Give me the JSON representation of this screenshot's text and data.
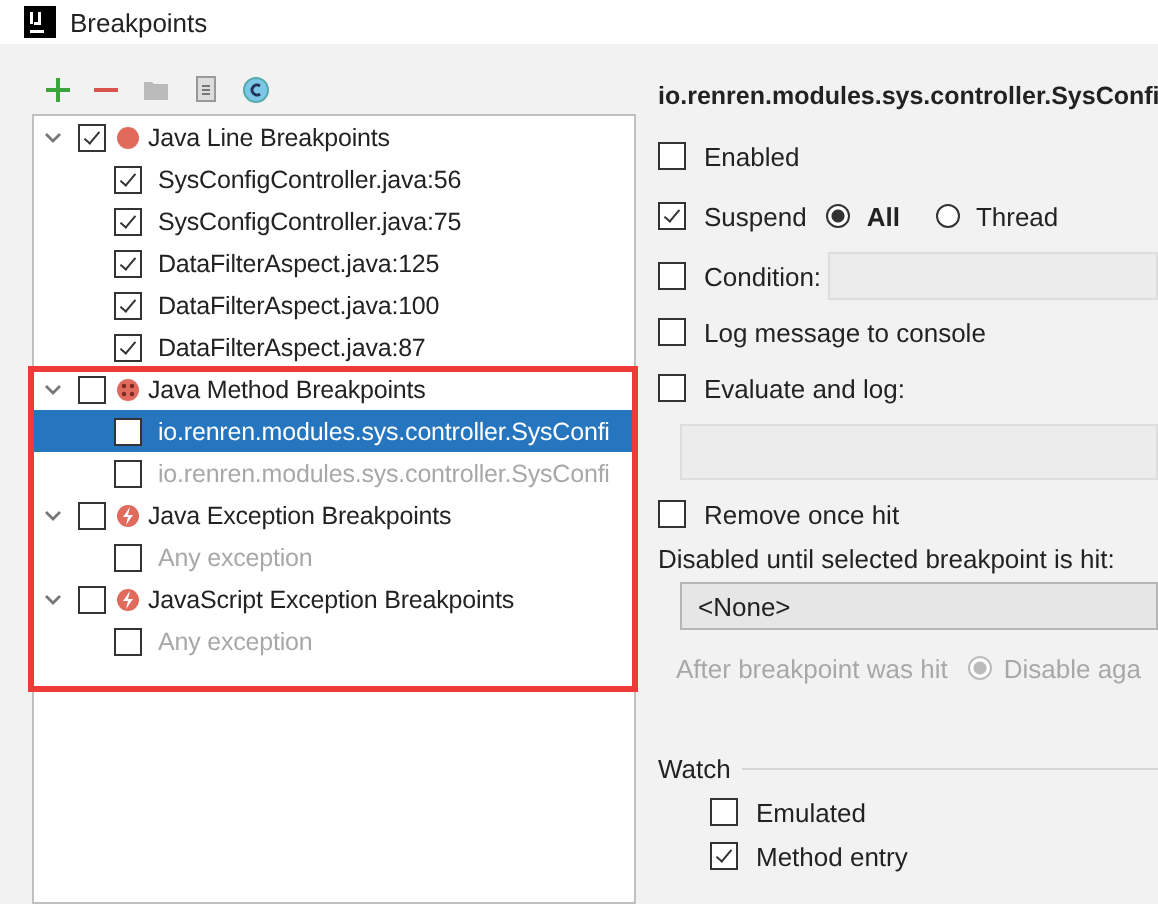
{
  "window": {
    "title": "Breakpoints"
  },
  "tree": [
    {
      "label": "Java Line Breakpoints",
      "kind": "line",
      "checked": true,
      "expanded": true,
      "children": [
        {
          "label": "SysConfigController.java:56",
          "checked": true,
          "selected": false,
          "disabled": false
        },
        {
          "label": "SysConfigController.java:75",
          "checked": true,
          "selected": false,
          "disabled": false
        },
        {
          "label": "DataFilterAspect.java:125",
          "checked": true,
          "selected": false,
          "disabled": false
        },
        {
          "label": "DataFilterAspect.java:100",
          "checked": true,
          "selected": false,
          "disabled": false
        },
        {
          "label": "DataFilterAspect.java:87",
          "checked": true,
          "selected": false,
          "disabled": false
        }
      ]
    },
    {
      "label": "Java Method Breakpoints",
      "kind": "method",
      "checked": false,
      "expanded": true,
      "children": [
        {
          "label": "io.renren.modules.sys.controller.SysConfi",
          "checked": false,
          "selected": true,
          "disabled": false
        },
        {
          "label": "io.renren.modules.sys.controller.SysConfi",
          "checked": false,
          "selected": false,
          "disabled": true
        }
      ]
    },
    {
      "label": "Java Exception Breakpoints",
      "kind": "exception",
      "checked": false,
      "expanded": true,
      "children": [
        {
          "label": "Any exception",
          "checked": false,
          "selected": false,
          "disabled": true
        }
      ]
    },
    {
      "label": "JavaScript Exception Breakpoints",
      "kind": "exception",
      "checked": false,
      "expanded": true,
      "children": [
        {
          "label": "Any exception",
          "checked": false,
          "selected": false,
          "disabled": true
        }
      ]
    }
  ],
  "details": {
    "title": "io.renren.modules.sys.controller.SysConfi",
    "enabled": {
      "label": "Enabled",
      "checked": false
    },
    "suspend": {
      "label": "Suspend",
      "checked": true,
      "options": [
        {
          "label": "All",
          "selected": true
        },
        {
          "label": "Thread",
          "selected": false
        }
      ]
    },
    "condition": {
      "label": "Condition:",
      "checked": false
    },
    "log_message": {
      "label": "Log message to console",
      "checked": false
    },
    "evaluate": {
      "label": "Evaluate and log:",
      "checked": false
    },
    "remove_once_hit": {
      "label": "Remove once hit",
      "checked": false
    },
    "disabled_until": {
      "label": "Disabled until selected breakpoint is hit:",
      "value": "<None>"
    },
    "after_hit": {
      "label": "After breakpoint was hit",
      "disabled": true,
      "option": {
        "label": "Disable aga",
        "selected": true
      }
    },
    "watch": {
      "title": "Watch",
      "options": [
        {
          "label": "Emulated",
          "checked": false
        },
        {
          "label": "Method entry",
          "checked": true
        }
      ]
    }
  }
}
